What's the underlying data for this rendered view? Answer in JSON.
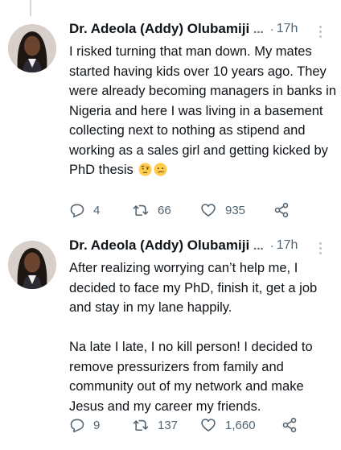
{
  "tweets": [
    {
      "author": "Dr. Adeola (Addy) Olubamiji",
      "truncation": "...",
      "separator": "·",
      "time": "17h",
      "paragraphs": [
        "I risked turning that man down. My mates started having kids over 10 years ago. They were already becoming managers in banks in Nigeria and here I was living in a basement collecting next to nothing as stipend and working as a sales girl and getting kicked by PhD thesis"
      ],
      "emojis": [
        "face-with-raised-eyebrow-emoji",
        "confused-face-emoji"
      ],
      "reply_count": "4",
      "retweet_count": "66",
      "like_count": "935"
    },
    {
      "author": "Dr. Adeola (Addy) Olubamiji",
      "truncation": "...",
      "separator": "·",
      "time": "17h",
      "paragraphs": [
        "After realizing worrying can’t help me, I decided to face my PhD, finish it, get a job and stay in my lane happily.",
        "Na late I late, I no kill person! I decided to remove pressurizers from family and community out of my network and make Jesus and my career my friends."
      ],
      "reply_count": "9",
      "retweet_count": "137",
      "like_count": "1,660"
    }
  ],
  "colors": {
    "text": "#0f1419",
    "muted": "#536471",
    "thread_line": "#cfd9de",
    "emoji": "#ffcc4d"
  },
  "icons": [
    "reply-icon",
    "retweet-icon",
    "like-icon",
    "share-icon",
    "more-options-icon"
  ]
}
